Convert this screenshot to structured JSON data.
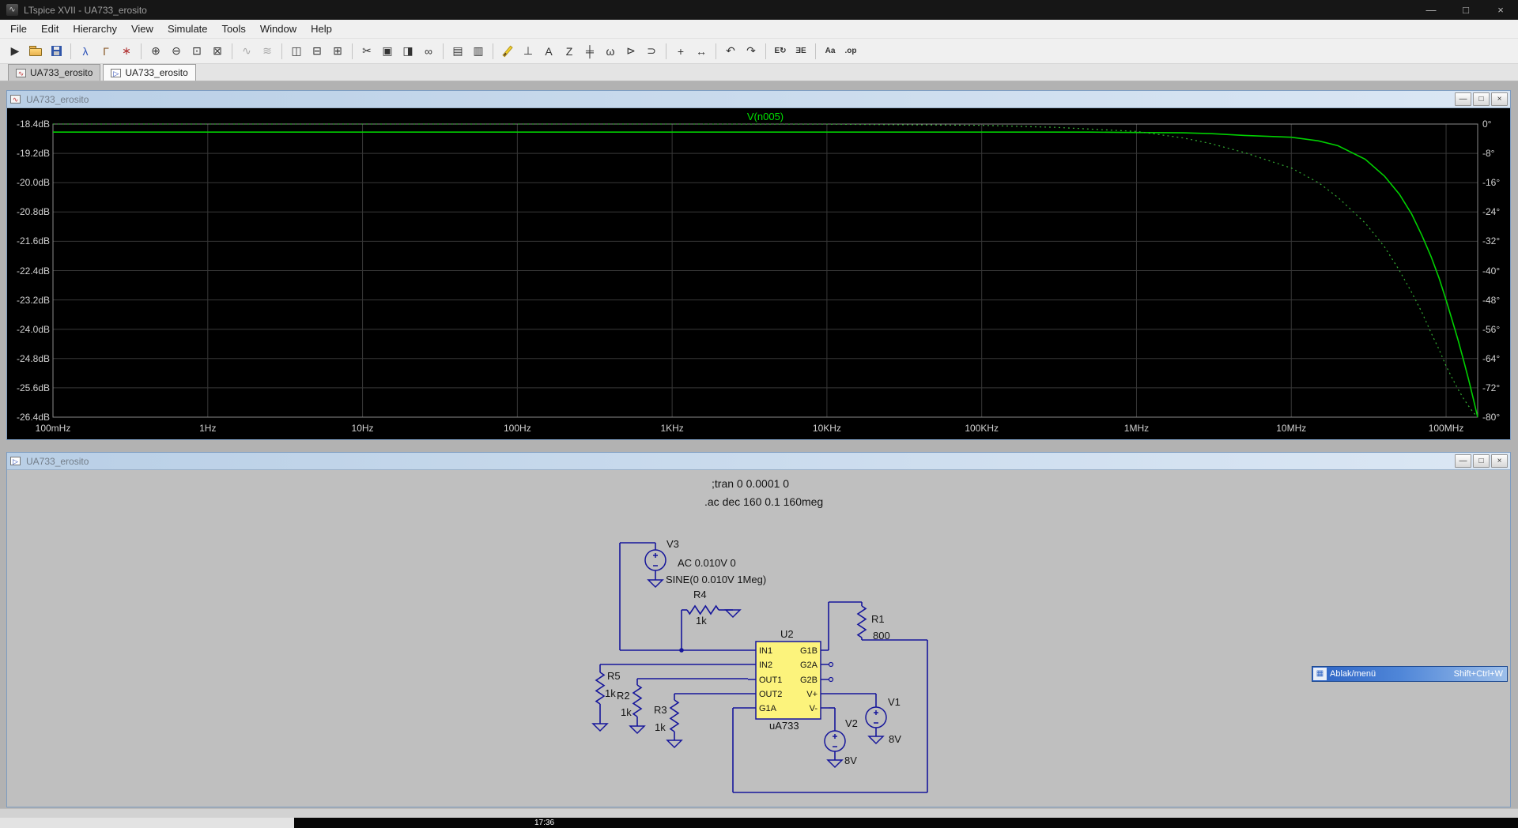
{
  "window": {
    "title": "LTspice XVII - UA733_erosito"
  },
  "window_controls": {
    "minimize": "—",
    "maximize": "□",
    "close": "×"
  },
  "menu": {
    "items": [
      "File",
      "Edit",
      "Hierarchy",
      "View",
      "Simulate",
      "Tools",
      "Window",
      "Help"
    ]
  },
  "toolbar": {
    "icons": [
      {
        "name": "run-icon",
        "glyph": "▶",
        "color": "#303030"
      },
      {
        "name": "open-icon",
        "shape": "folder"
      },
      {
        "name": "save-icon",
        "shape": "floppy"
      },
      {
        "divider": true
      },
      {
        "name": "run-man-icon",
        "glyph": "λ",
        "color": "#2a50b8"
      },
      {
        "name": "control-panel-icon",
        "glyph": "Γ",
        "color": "#8a5a2a"
      },
      {
        "name": "halt-icon",
        "glyph": "∗",
        "color": "#b03030"
      },
      {
        "divider": true
      },
      {
        "name": "zoom-in-icon",
        "glyph": "⊕",
        "color": "#333333"
      },
      {
        "name": "zoom-out-icon",
        "glyph": "⊖",
        "color": "#333333"
      },
      {
        "name": "zoom-fit-icon",
        "glyph": "⊡",
        "color": "#333333"
      },
      {
        "name": "zoom-area-icon",
        "glyph": "⊠",
        "color": "#333333"
      },
      {
        "divider": true
      },
      {
        "name": "plot-settings-icon",
        "glyph": "∿",
        "color": "#a8a8a8"
      },
      {
        "name": "autorange-icon",
        "glyph": "≋",
        "color": "#a8a8a8"
      },
      {
        "divider": true
      },
      {
        "name": "tile-vertical-icon",
        "glyph": "◫",
        "color": "#333333"
      },
      {
        "name": "tile-horizontal-icon",
        "glyph": "⊟",
        "color": "#333333"
      },
      {
        "name": "cascade-windows-icon",
        "glyph": "⊞",
        "color": "#333333"
      },
      {
        "divider": true
      },
      {
        "name": "cut-icon",
        "glyph": "✂",
        "color": "#333333"
      },
      {
        "name": "copy-icon",
        "glyph": "▣",
        "color": "#333333"
      },
      {
        "name": "paste-icon",
        "glyph": "◨",
        "color": "#333333"
      },
      {
        "name": "find-icon",
        "glyph": "∞",
        "color": "#333333"
      },
      {
        "divider": true
      },
      {
        "name": "print-icon",
        "glyph": "▤",
        "color": "#333333"
      },
      {
        "name": "print-preview-icon",
        "glyph": "▥",
        "color": "#333333"
      },
      {
        "divider": true
      },
      {
        "name": "wire-icon",
        "shape": "pencil"
      },
      {
        "name": "ground-icon",
        "glyph": "⊥",
        "color": "#333333"
      },
      {
        "name": "label-net-icon",
        "glyph": "A",
        "color": "#333333"
      },
      {
        "name": "resistor-icon",
        "glyph": "Z",
        "color": "#333333"
      },
      {
        "name": "capacitor-icon",
        "glyph": "╪",
        "color": "#333333"
      },
      {
        "name": "inductor-icon",
        "glyph": "ω",
        "color": "#333333"
      },
      {
        "name": "diode-icon",
        "glyph": "⊳",
        "color": "#333333"
      },
      {
        "name": "component-icon",
        "glyph": "⊃",
        "color": "#333333"
      },
      {
        "divider": true
      },
      {
        "name": "move-icon",
        "glyph": "+",
        "color": "#333333"
      },
      {
        "name": "drag-icon",
        "glyph": "↔",
        "color": "#333333"
      },
      {
        "divider": true
      },
      {
        "name": "undo-icon",
        "glyph": "↶",
        "color": "#333333"
      },
      {
        "name": "redo-icon",
        "glyph": "↷",
        "color": "#333333"
      },
      {
        "divider": true
      },
      {
        "name": "rotate-icon",
        "glyph": "E↻",
        "color": "#333333"
      },
      {
        "name": "mirror-icon",
        "glyph": "ƎE",
        "color": "#333333"
      },
      {
        "divider": true
      },
      {
        "name": "text-icon",
        "glyph": "Aa",
        "color": "#333333"
      },
      {
        "name": "spice-directive-icon",
        "glyph": ".op",
        "color": "#333333"
      }
    ]
  },
  "tabs": [
    {
      "label": "UA733_erosito",
      "icon": "waveform",
      "active": false
    },
    {
      "label": "UA733_erosito",
      "icon": "schematic",
      "active": true
    }
  ],
  "plot_window": {
    "title": "UA733_erosito"
  },
  "schematic_window": {
    "title": "UA733_erosito"
  },
  "chart_data": {
    "type": "line",
    "title": "",
    "background": "#000000",
    "grid_color": "#383838",
    "frame_color": "#8c8c8c",
    "trace_label": "V(n005)",
    "x_axis": {
      "scale": "log",
      "unit": "Hz",
      "min": 0.1,
      "max": 160000000,
      "tick_labels": [
        "100mHz",
        "1Hz",
        "10Hz",
        "100Hz",
        "1KHz",
        "10KHz",
        "100KHz",
        "1MHz",
        "10MHz",
        "100MHz"
      ]
    },
    "y_axis_left": {
      "unit": "dB",
      "min": -26.4,
      "max": -18.4,
      "tick_labels": [
        "-18.4dB",
        "-19.2dB",
        "-20.0dB",
        "-20.8dB",
        "-21.6dB",
        "-22.4dB",
        "-23.2dB",
        "-24.0dB",
        "-24.8dB",
        "-25.6dB",
        "-26.4dB"
      ]
    },
    "y_axis_right": {
      "unit": "deg",
      "min": -80,
      "max": 0,
      "tick_labels": [
        "0°",
        "-8°",
        "-16°",
        "-24°",
        "-32°",
        "-40°",
        "-48°",
        "-56°",
        "-64°",
        "-72°",
        "-80°"
      ]
    },
    "series": [
      {
        "name": "V(n005) magnitude",
        "axis": "left",
        "style": "solid",
        "color": "#00d000",
        "points": [
          [
            0.1,
            -18.62
          ],
          [
            1,
            -18.62
          ],
          [
            10,
            -18.62
          ],
          [
            100,
            -18.62
          ],
          [
            1000,
            -18.62
          ],
          [
            10000,
            -18.62
          ],
          [
            100000,
            -18.62
          ],
          [
            500000,
            -18.62
          ],
          [
            1000000,
            -18.63
          ],
          [
            2000000,
            -18.64
          ],
          [
            3000000,
            -18.66
          ],
          [
            5000000,
            -18.71
          ],
          [
            10000000,
            -18.76
          ],
          [
            15000000,
            -18.86
          ],
          [
            20000000,
            -18.99
          ],
          [
            30000000,
            -19.36
          ],
          [
            40000000,
            -19.82
          ],
          [
            50000000,
            -20.32
          ],
          [
            60000000,
            -20.86
          ],
          [
            70000000,
            -21.45
          ],
          [
            80000000,
            -22.02
          ],
          [
            90000000,
            -22.6
          ],
          [
            100000000,
            -23.2
          ],
          [
            110000000,
            -23.78
          ],
          [
            120000000,
            -24.32
          ],
          [
            130000000,
            -24.86
          ],
          [
            140000000,
            -25.38
          ],
          [
            150000000,
            -25.9
          ],
          [
            160000000,
            -26.4
          ]
        ]
      },
      {
        "name": "V(n005) phase",
        "axis": "right",
        "style": "dashed",
        "color": "#35ae35",
        "points": [
          [
            0.1,
            0
          ],
          [
            1000,
            0
          ],
          [
            10000,
            -0.05
          ],
          [
            100000,
            -0.35
          ],
          [
            300000,
            -0.9
          ],
          [
            1000000,
            -2.0
          ],
          [
            2000000,
            -3.8
          ],
          [
            3000000,
            -5.3
          ],
          [
            5000000,
            -7.8
          ],
          [
            10000000,
            -12
          ],
          [
            15000000,
            -16
          ],
          [
            20000000,
            -20
          ],
          [
            30000000,
            -27
          ],
          [
            40000000,
            -33.5
          ],
          [
            50000000,
            -40
          ],
          [
            60000000,
            -46
          ],
          [
            70000000,
            -51.5
          ],
          [
            80000000,
            -57
          ],
          [
            90000000,
            -61.5
          ],
          [
            100000000,
            -66
          ],
          [
            110000000,
            -69.5
          ],
          [
            120000000,
            -72.5
          ],
          [
            130000000,
            -75
          ],
          [
            140000000,
            -77
          ],
          [
            150000000,
            -78.7
          ],
          [
            160000000,
            -80
          ]
        ]
      }
    ]
  },
  "schematic": {
    "wire_color": "#16169b",
    "chip_fill": "#fcf37c",
    "directives": [
      ";tran 0 0.0001 0",
      ".ac dec 160 0.1 160meg"
    ],
    "u2": {
      "ref": "U2",
      "part": "uA733",
      "pins_left": [
        "IN1",
        "IN2",
        "OUT1",
        "OUT2",
        "G1A"
      ],
      "pins_right": [
        "G1B",
        "G2A",
        "G2B",
        "V+",
        "V-"
      ]
    },
    "v3": {
      "ref": "V3",
      "value1": "AC 0.010V 0",
      "value2": "SINE(0 0.010V 1Meg)"
    },
    "r1": {
      "ref": "R1",
      "value": "800"
    },
    "r2": {
      "ref": "R2",
      "value": "1k"
    },
    "r3": {
      "ref": "R3",
      "value": "1k"
    },
    "r4": {
      "ref": "R4",
      "value": "1k"
    },
    "r5": {
      "ref": "R5",
      "value": "1k"
    },
    "v1": {
      "ref": "V1",
      "value": "8V"
    },
    "v2": {
      "ref": "V2",
      "value": "8V"
    }
  },
  "overlay_hint": {
    "label": "Ablak/menü",
    "shortcut": "Shift+Ctrl+W"
  },
  "player_bar": {
    "timestamp": "17:36"
  }
}
